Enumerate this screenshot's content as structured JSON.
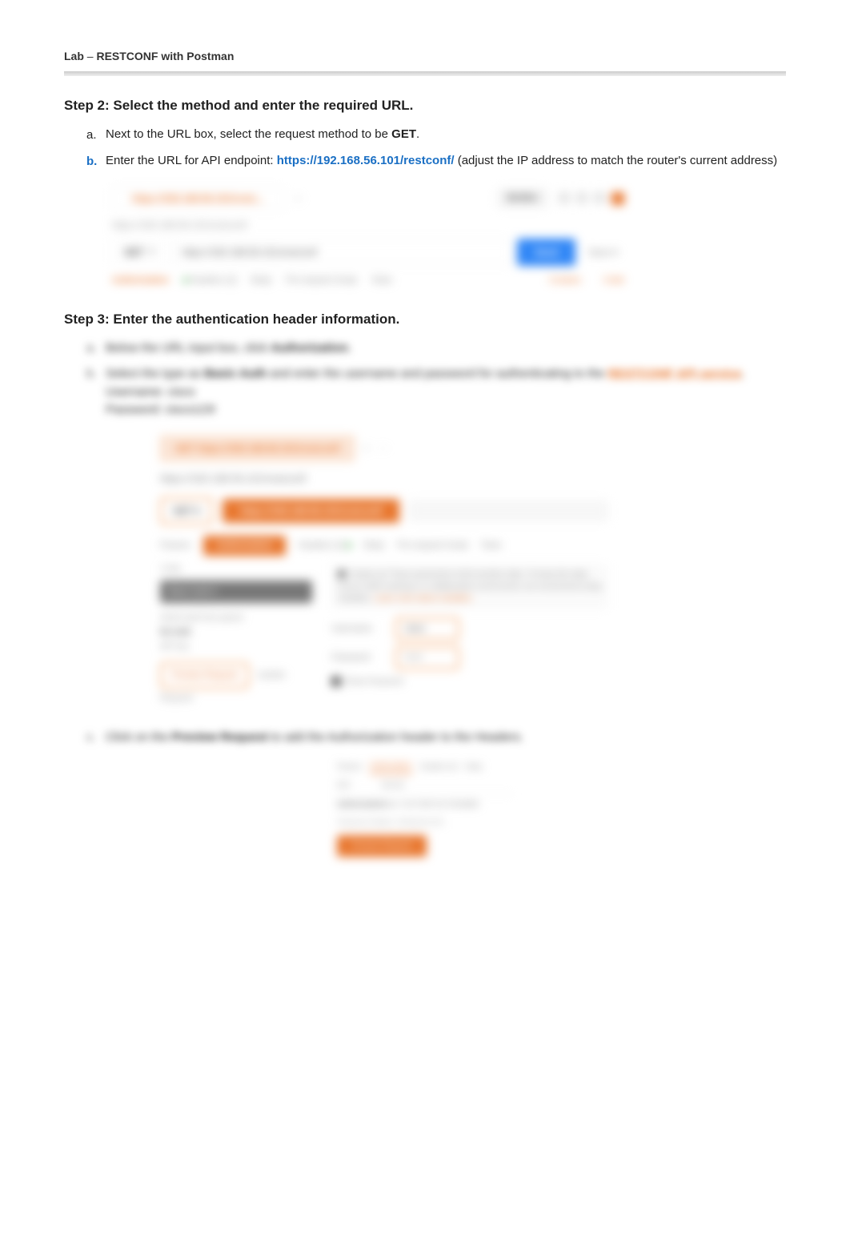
{
  "header": {
    "lab": "Lab",
    "sep": " – ",
    "title": "RESTCONF with Postman"
  },
  "step2": {
    "heading": "Step 2: Select the method and enter the required URL.",
    "a": {
      "pre": "Next to the URL box, select the request method to be ",
      "bold": "GET",
      "post": "."
    },
    "b": {
      "pre": "Enter the URL for API endpoint: ",
      "url": "https://192.168.56.101/restconf/",
      "post": "   (adjust the IP address to match the router's current address)"
    },
    "shot1": {
      "tab": "https://192.168.56.101/restc...",
      "builder": "Builder",
      "subtitle": "https://192.168.56.101/restconf/",
      "method": "GET",
      "urlbox": "https://192.168.56.101/restconf/",
      "send": "Send",
      "save": "Save",
      "tabs": {
        "auth": "Authorization",
        "headers": "Headers",
        "body": "Body",
        "prereq": "Pre-request Script",
        "tests": "Tests",
        "h2": "Headers (2)"
      },
      "cookies": "Cookies",
      "code": "Code"
    }
  },
  "step3": {
    "heading": "Step 3: Enter the authentication header information.",
    "a": {
      "pre": "Below the URL input box, click ",
      "bold": "Authorization",
      "post": "."
    },
    "b": {
      "pre": "Select the type as ",
      "bold": "Basic Auth",
      "mid": " and enter the username and password for authenticating to the ",
      "red": "RESTCONF API service",
      "cred_u_l": "Username",
      "cred_u_v": "cisco",
      "cred_p_l": "Password",
      "cred_p_v": "cisco123!"
    },
    "shot2": {
      "tab": "GET https://192.168.56.101/restconf/",
      "title": "https://192.168.56.101/restconf/",
      "method": "GET",
      "pill": "https://192.168.56.101/restconf/",
      "tabs": {
        "params": "Params",
        "auth": "Authorization",
        "headers": "Headers (2)",
        "body": "Body",
        "prereq": "Pre-request Script",
        "tests": "Tests"
      },
      "type_label": "TYPE",
      "type_value": "Basic Auth",
      "list": {
        "inherit": "Inherit auth from parent",
        "noauth": "No Auth",
        "apikey": "API Key"
      },
      "info": "Heads up! These parameters hold sensitive data. To keep this data secure while working in a collaborative environment, we recommend using variables.",
      "learn": "Learn more about variables",
      "username_l": "Username",
      "username_v": "cisco",
      "password_l": "Password",
      "password_v": "••••",
      "show": "Show Password",
      "preview": "Preview Request",
      "update": "Update Request"
    },
    "c": {
      "pre": "Click on the ",
      "bold": "Preview Request",
      "post": " to add the Authorization header to the Headers."
    },
    "shot3": {
      "tabs": {
        "params": "Params",
        "auth": "Authorization",
        "headers": "Headers (3)",
        "body": "Body"
      },
      "key": "KEY",
      "value": "VALUE",
      "auth_k": "Authorization",
      "auth_v": "Basic Y2lzY286Y2lzY28xMjMh",
      "temp": "Temporary Headers. Clicking this will...",
      "preview": "Preview Request"
    }
  }
}
